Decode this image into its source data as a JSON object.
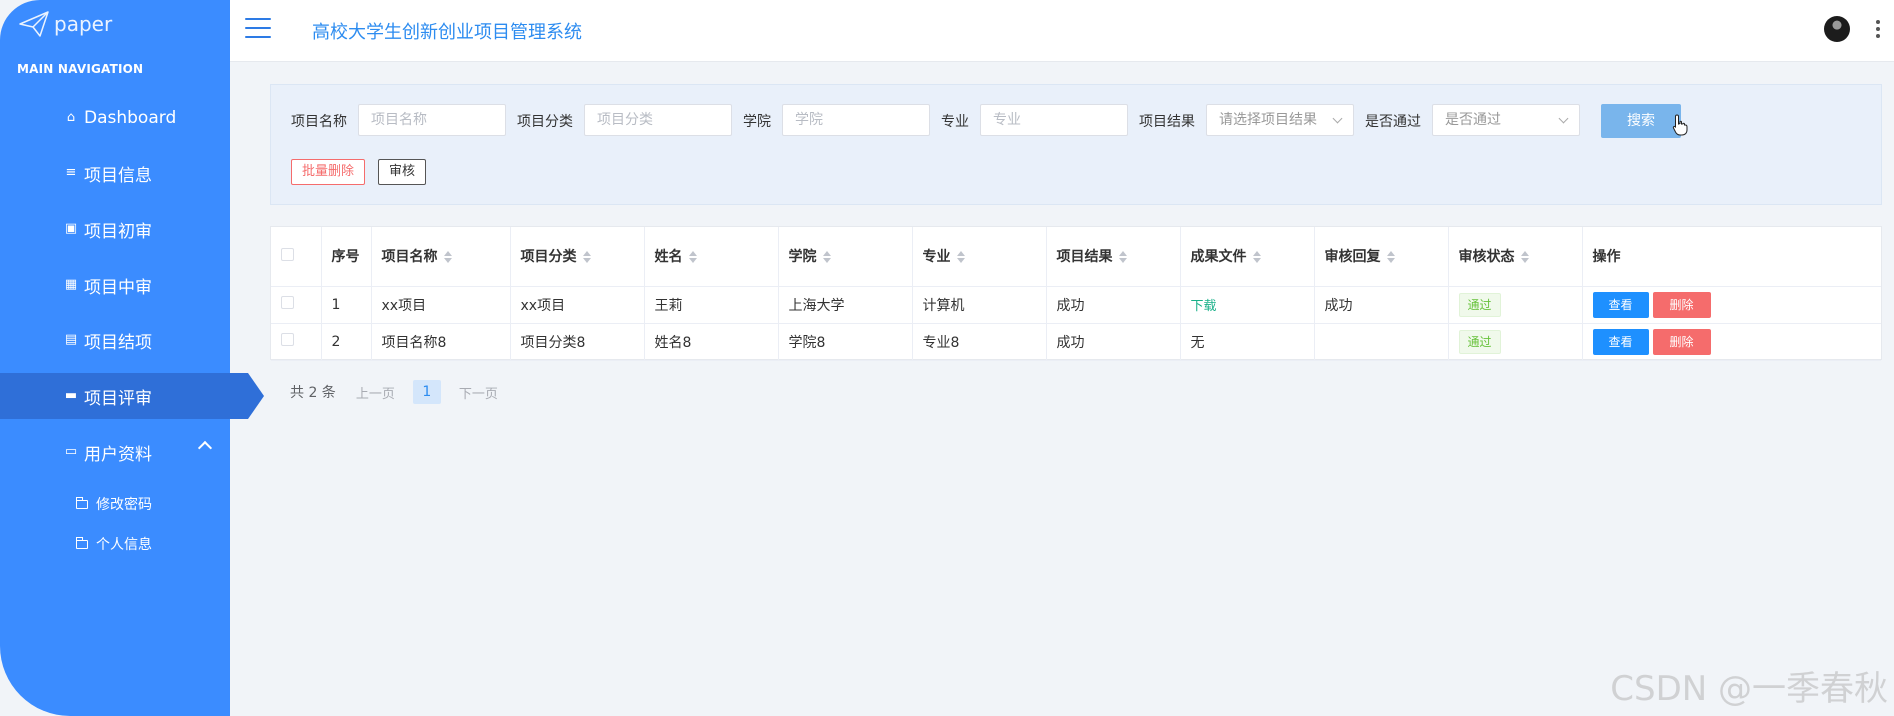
{
  "sidebar": {
    "logo_text": "paper",
    "nav_title": "MAIN NAVIGATION",
    "items": [
      {
        "label": "Dashboard",
        "icon": "home-icon"
      },
      {
        "label": "项目信息",
        "icon": "sliders-icon"
      },
      {
        "label": "项目初审",
        "icon": "clipboard-icon"
      },
      {
        "label": "项目中审",
        "icon": "grid-icon"
      },
      {
        "label": "项目结项",
        "icon": "chart-icon"
      },
      {
        "label": "项目评审",
        "icon": "briefcase-icon",
        "active": true
      },
      {
        "label": "用户资料",
        "icon": "card-icon",
        "expanded": true
      }
    ],
    "sub_items": [
      {
        "label": "修改密码",
        "icon": "folder-icon"
      },
      {
        "label": "个人信息",
        "icon": "folder-icon"
      }
    ]
  },
  "header": {
    "title": "高校大学生创新创业项目管理系统"
  },
  "search": {
    "fields": [
      {
        "label": "项目名称",
        "placeholder": "项目名称"
      },
      {
        "label": "项目分类",
        "placeholder": "项目分类"
      },
      {
        "label": "学院",
        "placeholder": "学院"
      },
      {
        "label": "专业",
        "placeholder": "专业"
      },
      {
        "label": "项目结果",
        "placeholder": "请选择项目结果"
      },
      {
        "label": "是否通过",
        "placeholder": "是否通过"
      }
    ],
    "search_button": "搜索",
    "batch_delete_button": "批量删除",
    "review_button": "审核"
  },
  "table": {
    "headers": [
      "序号",
      "项目名称",
      "项目分类",
      "姓名",
      "学院",
      "专业",
      "项目结果",
      "成果文件",
      "审核回复",
      "审核状态",
      "操作"
    ],
    "rows": [
      {
        "index": "1",
        "name": "xx项目",
        "category": "xx项目",
        "person": "王莉",
        "college": "上海大学",
        "major": "计算机",
        "result": "成功",
        "file": "下载",
        "reply": "成功",
        "status": "通过",
        "view": "查看",
        "delete": "删除"
      },
      {
        "index": "2",
        "name": "项目名称8",
        "category": "项目分类8",
        "person": "姓名8",
        "college": "学院8",
        "major": "专业8",
        "result": "成功",
        "file": "无",
        "reply": "",
        "status": "通过",
        "view": "查看",
        "delete": "删除"
      }
    ]
  },
  "pagination": {
    "total": "共 2 条",
    "prev": "上一页",
    "current": "1",
    "next": "下一页"
  },
  "watermark": "CSDN @一季春秋",
  "colors": {
    "sidebar": "#3b8cff",
    "sidebar_active": "#2f6fd8",
    "title": "#2d8cf0",
    "search_btn": "#79b5ec",
    "danger": "#f56c6c",
    "primary": "#1e90ff",
    "success": "#67c23a"
  }
}
